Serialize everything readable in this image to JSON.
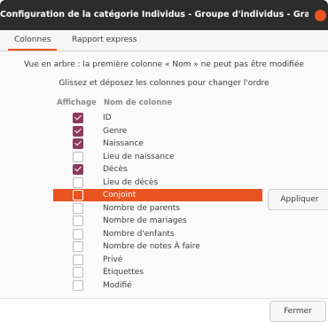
{
  "window": {
    "title": "Configuration de la catégorie Individus - Groupe d'individus - Gramps",
    "close_icon": "close-icon",
    "accent_color": "#e95420"
  },
  "tabs": [
    {
      "label": "Colonnes",
      "active": true
    },
    {
      "label": "Rapport express",
      "active": false
    }
  ],
  "info": {
    "line1": "Vue en arbre : la première colonne « Nom » ne peut pas être modifiée",
    "line2": "Glissez et déposez les colonnes pour changer l'ordre"
  },
  "table": {
    "headers": {
      "display": "Affichage",
      "name": "Nom de colonne"
    },
    "rows": [
      {
        "label": "ID",
        "checked": true,
        "selected": false
      },
      {
        "label": "Genre",
        "checked": true,
        "selected": false
      },
      {
        "label": "Naissance",
        "checked": true,
        "selected": false
      },
      {
        "label": "Lieu de naissance",
        "checked": false,
        "selected": false
      },
      {
        "label": "Décès",
        "checked": true,
        "selected": false
      },
      {
        "label": "Lieu de décès",
        "checked": false,
        "selected": false
      },
      {
        "label": "Conjoint",
        "checked": false,
        "selected": true
      },
      {
        "label": "Nombre de parents",
        "checked": false,
        "selected": false
      },
      {
        "label": "Nombre de mariages",
        "checked": false,
        "selected": false
      },
      {
        "label": "Nombre d'enfants",
        "checked": false,
        "selected": false
      },
      {
        "label": "Nombre de notes À faire",
        "checked": false,
        "selected": false
      },
      {
        "label": "Privé",
        "checked": false,
        "selected": false
      },
      {
        "label": "Étiquettes",
        "checked": false,
        "selected": false
      },
      {
        "label": "Modifié",
        "checked": false,
        "selected": false
      }
    ]
  },
  "buttons": {
    "apply": "Appliquer",
    "close": "Fermer"
  }
}
